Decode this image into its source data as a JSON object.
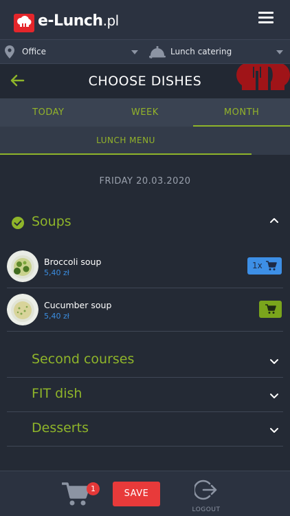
{
  "header": {
    "logo_text": "e-Lunch",
    "logo_suffix": ".pl",
    "menu_icon": "hamburger-menu-icon"
  },
  "selectors": {
    "location": "Office",
    "service": "Lunch catering"
  },
  "titlebar": {
    "title": "CHOOSE DISHES"
  },
  "tabs": [
    {
      "label": "TODAY"
    },
    {
      "label": "WEEK"
    },
    {
      "label": "MONTH",
      "active": true
    }
  ],
  "subtab": {
    "label": "LUNCH MENU"
  },
  "date": "FRIDAY 20.03.2020",
  "categories": {
    "soups": {
      "title": "Soups",
      "expanded": true,
      "dishes": [
        {
          "name": "Broccoli soup",
          "price": "5,40 zł",
          "quantity": "1x"
        },
        {
          "name": "Cucumber soup",
          "price": "5,40 zł"
        }
      ]
    },
    "collapsed": [
      {
        "title": "Second courses"
      },
      {
        "title": "FIT dish"
      },
      {
        "title": "Desserts"
      }
    ]
  },
  "bottom": {
    "cart_count": "1",
    "save_label": "SAVE",
    "logout_label": "LOGOUT"
  },
  "colors": {
    "accent_green": "#8fb52a",
    "price_blue": "#3b8de0",
    "save_red": "#e83a3a",
    "background": "#242a35"
  }
}
